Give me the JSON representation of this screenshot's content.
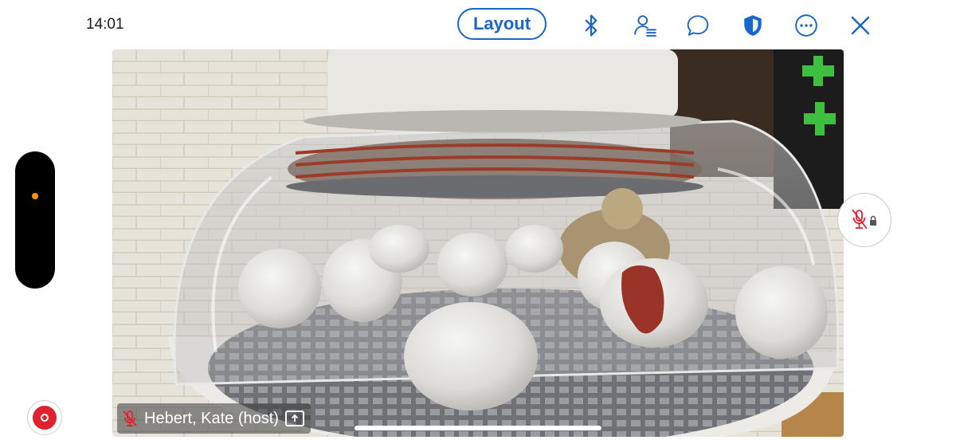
{
  "status": {
    "time": "14:01"
  },
  "toolbar": {
    "layout_label": "Layout",
    "icons": [
      "bluetooth-icon",
      "participants-icon",
      "chat-icon",
      "security-shield-icon",
      "more-icon",
      "close-icon"
    ],
    "accent_color": "#1a66c9"
  },
  "video": {
    "participant_label": "Hebert, Kate (host)"
  },
  "controls": {
    "record_color": "#e0212e",
    "indicator_dot_color": "#ff9500"
  }
}
